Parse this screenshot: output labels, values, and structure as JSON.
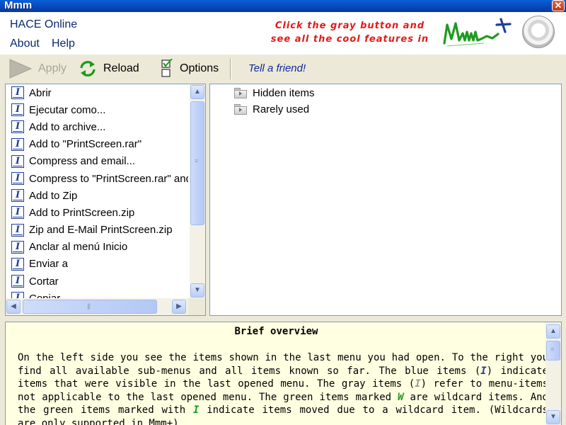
{
  "window": {
    "title": "Mmm"
  },
  "menu": {
    "hace_online": "HACE Online",
    "about": "About",
    "help": "Help"
  },
  "promo": {
    "line1": "Click the gray button and",
    "line2": "see all the cool features in",
    "logo_text": "Mmm+"
  },
  "toolbar": {
    "apply": "Apply",
    "reload": "Reload",
    "options": "Options",
    "tell_friend": "Tell a friend!"
  },
  "left_list": {
    "items": [
      "Abrir",
      "Ejecutar como...",
      "Add to archive...",
      "Add to \"PrintScreen.rar\"",
      "Compress and email...",
      "Compress to \"PrintScreen.rar\" and email",
      "Add to Zip",
      "Add to PrintScreen.zip",
      "Zip and E-Mail PrintScreen.zip",
      "Anclar al menú Inicio",
      "Enviar a",
      "Cortar",
      "Copiar"
    ]
  },
  "right_tree": {
    "items": [
      "Hidden items",
      "Rarely used"
    ]
  },
  "overview": {
    "title": "Brief overview",
    "p1": "On the left side you see the items shown in the last menu you had open. To the right you find all available sub-menus and all items known so far. The blue items (",
    "icon_blue": "I",
    "p2": ") indicate items that were visible in the last opened menu. The gray items (",
    "icon_gray": "I",
    "p3": ") refer to menu-items not applicable to the last opened menu. The green items marked ",
    "icon_w": "W",
    "p4": " are wildcard items. And the green items marked with ",
    "icon_green": "I",
    "p5": " indicate items moved due to a wildcard item. (Wildcards are only supported in Mmm+)"
  },
  "colors": {
    "titlebar": "#0747b8",
    "promo": "#e31a1a",
    "link_blue": "#12289c",
    "overview_bg": "#ffffe1",
    "logo_green": "#1e9a1e"
  }
}
